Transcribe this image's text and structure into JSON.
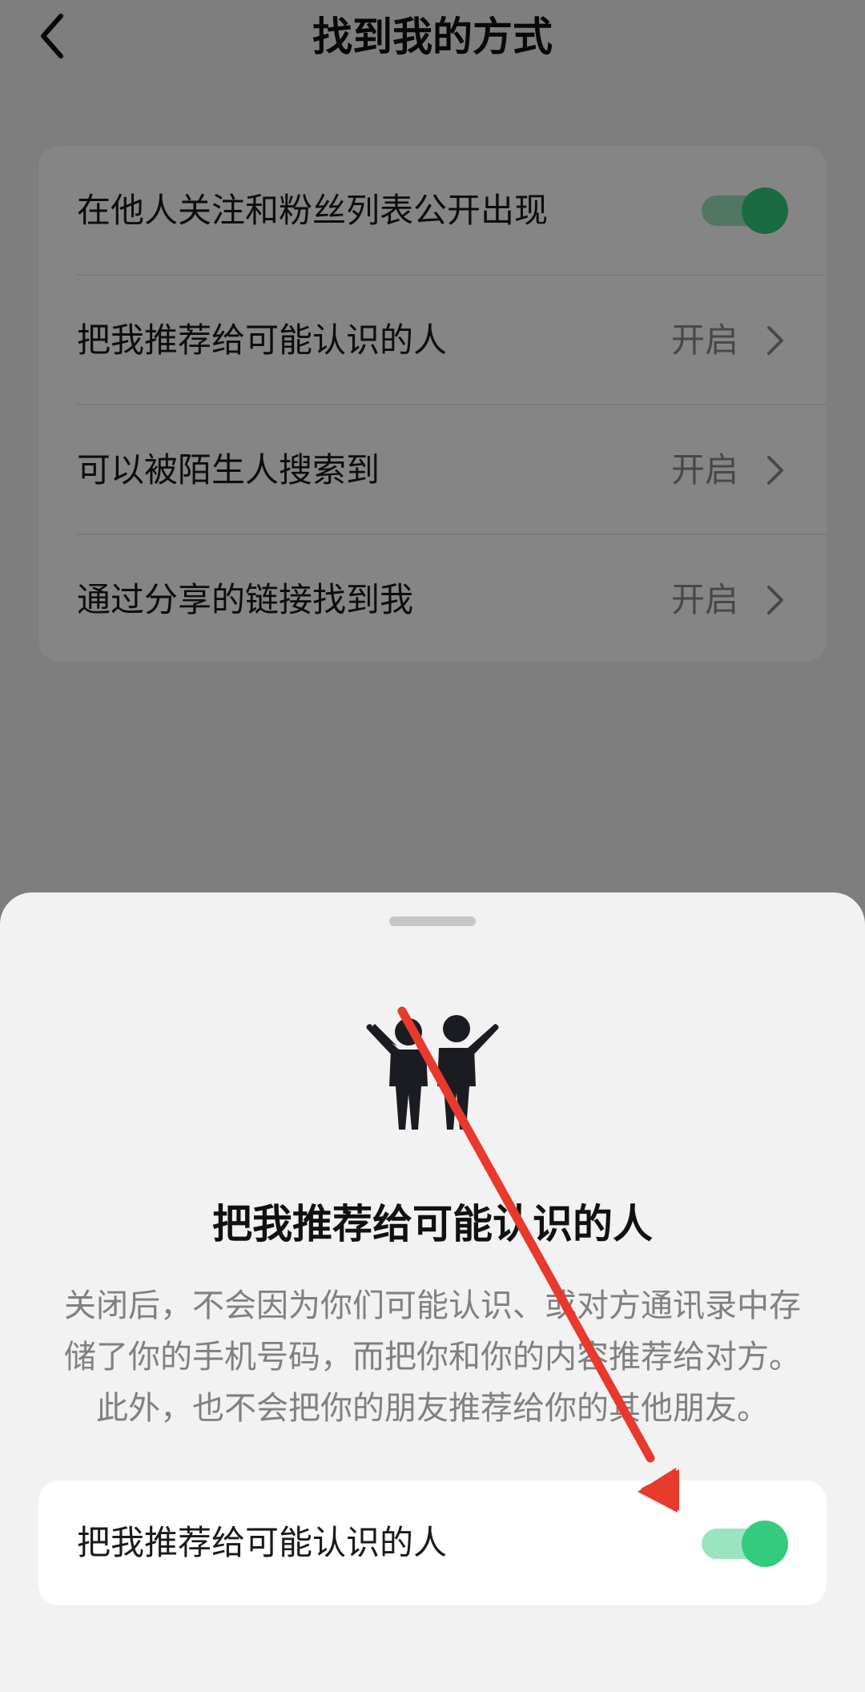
{
  "header": {
    "title": "找到我的方式",
    "back_icon": "chevron-left-icon"
  },
  "settings": {
    "items": [
      {
        "label": "在他人关注和粉丝列表公开出现",
        "control": "toggle",
        "on": true
      },
      {
        "label": "把我推荐给可能认识的人",
        "value": "开启"
      },
      {
        "label": "可以被陌生人搜索到",
        "value": "开启"
      },
      {
        "label": "通过分享的链接找到我",
        "value": "开启"
      }
    ]
  },
  "sheet": {
    "icon": "people-icon",
    "title": "把我推荐给可能认识的人",
    "description_lines": [
      "关闭后，不会因为你们可能认识、或对方通讯录中存",
      "储了你的手机号码，而把你和你的内容推荐给对方。",
      "此外，也不会把你的朋友推荐给你的其他朋友。"
    ],
    "toggle_row": {
      "label": "把我推荐给可能认识的人",
      "on": true
    }
  },
  "colors": {
    "toggle_on_knob": "#33cc7f",
    "toggle_on_track": "#9ce3bf",
    "annotation_arrow": "#e8392c",
    "sheet_background": "#f2f2f2"
  }
}
